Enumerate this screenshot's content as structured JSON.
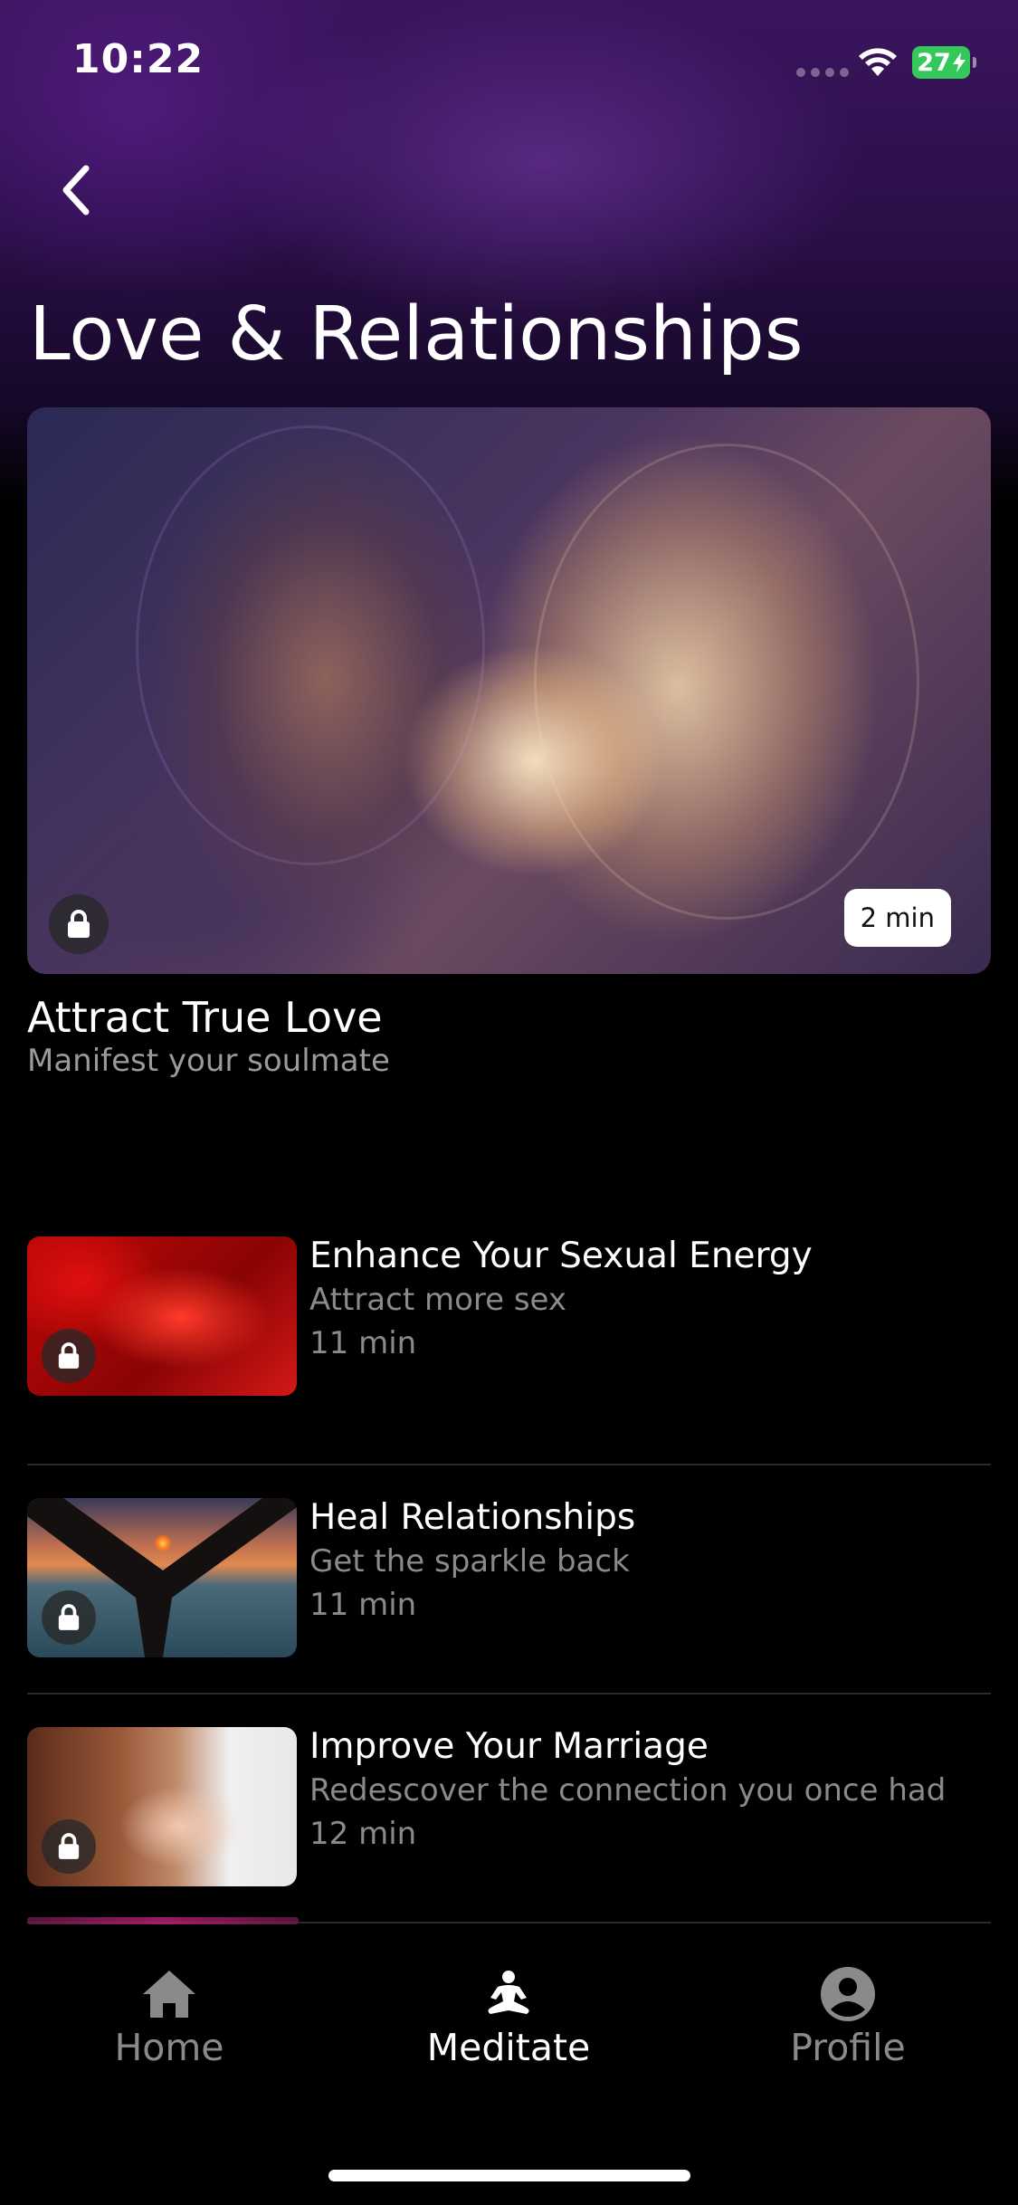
{
  "status_bar": {
    "time": "10:22",
    "battery": "27"
  },
  "header": {
    "title": "Love & Relationships"
  },
  "featured": {
    "title": "Attract True Love",
    "subtitle": "Manifest your soulmate",
    "duration": "2 min",
    "locked": true
  },
  "sessions": [
    {
      "title": "Enhance Your Sexual Energy",
      "subtitle": "Attract more sex",
      "duration": "11 min",
      "locked": true
    },
    {
      "title": "Heal Relationships",
      "subtitle": "Get the sparkle back",
      "duration": "11 min",
      "locked": true
    },
    {
      "title": "Improve Your Marriage",
      "subtitle": "Redescover the connection you once had",
      "duration": "12 min",
      "locked": true
    }
  ],
  "tabs": [
    {
      "label": "Home",
      "icon": "home-icon",
      "active": false
    },
    {
      "label": "Meditate",
      "icon": "meditate-icon",
      "active": true
    },
    {
      "label": "Profile",
      "icon": "profile-icon",
      "active": false
    }
  ],
  "colors": {
    "battery": "#34c759",
    "active_tab": "#ffffff",
    "inactive_tab": "#8a8a8a",
    "header_bg": "#2a0f48"
  }
}
